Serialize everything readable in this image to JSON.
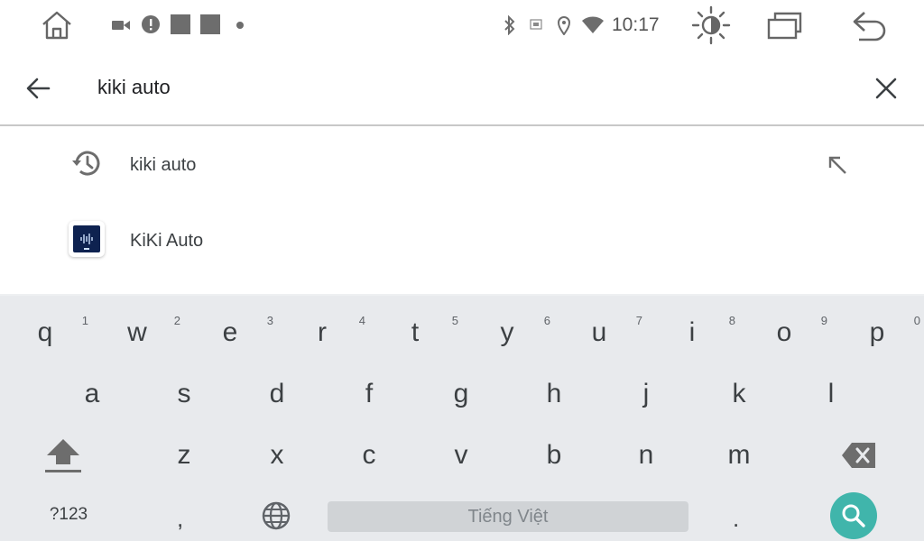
{
  "status_bar": {
    "time": "10:17",
    "icons": [
      "home-icon",
      "camera-icon",
      "alert-icon",
      "notification-square-icon",
      "notification-square-icon",
      "dot-icon",
      "bluetooth-icon",
      "cast-icon",
      "location-icon",
      "wifi-icon",
      "brightness-icon",
      "recents-icon",
      "back-icon"
    ]
  },
  "search": {
    "query": "kiki auto"
  },
  "suggestions": [
    {
      "type": "history",
      "label": "kiki auto",
      "icon": "history-icon",
      "action_icon": "fill-query-arrow-icon"
    },
    {
      "type": "app",
      "label": "KiKi Auto",
      "icon": "kiki-auto-app-icon"
    }
  ],
  "keyboard": {
    "row1": [
      {
        "letter": "q",
        "hint": "1"
      },
      {
        "letter": "w",
        "hint": "2"
      },
      {
        "letter": "e",
        "hint": "3"
      },
      {
        "letter": "r",
        "hint": "4"
      },
      {
        "letter": "t",
        "hint": "5"
      },
      {
        "letter": "y",
        "hint": "6"
      },
      {
        "letter": "u",
        "hint": "7"
      },
      {
        "letter": "i",
        "hint": "8"
      },
      {
        "letter": "o",
        "hint": "9"
      },
      {
        "letter": "p",
        "hint": "0"
      }
    ],
    "row2": [
      "a",
      "s",
      "d",
      "f",
      "g",
      "h",
      "j",
      "k",
      "l"
    ],
    "row3": [
      "z",
      "x",
      "c",
      "v",
      "b",
      "n",
      "m"
    ],
    "symbols_label": "?123",
    "comma": ",",
    "period": ".",
    "space_label": "Tiếng Việt",
    "accent_color": "#40b5ab"
  }
}
